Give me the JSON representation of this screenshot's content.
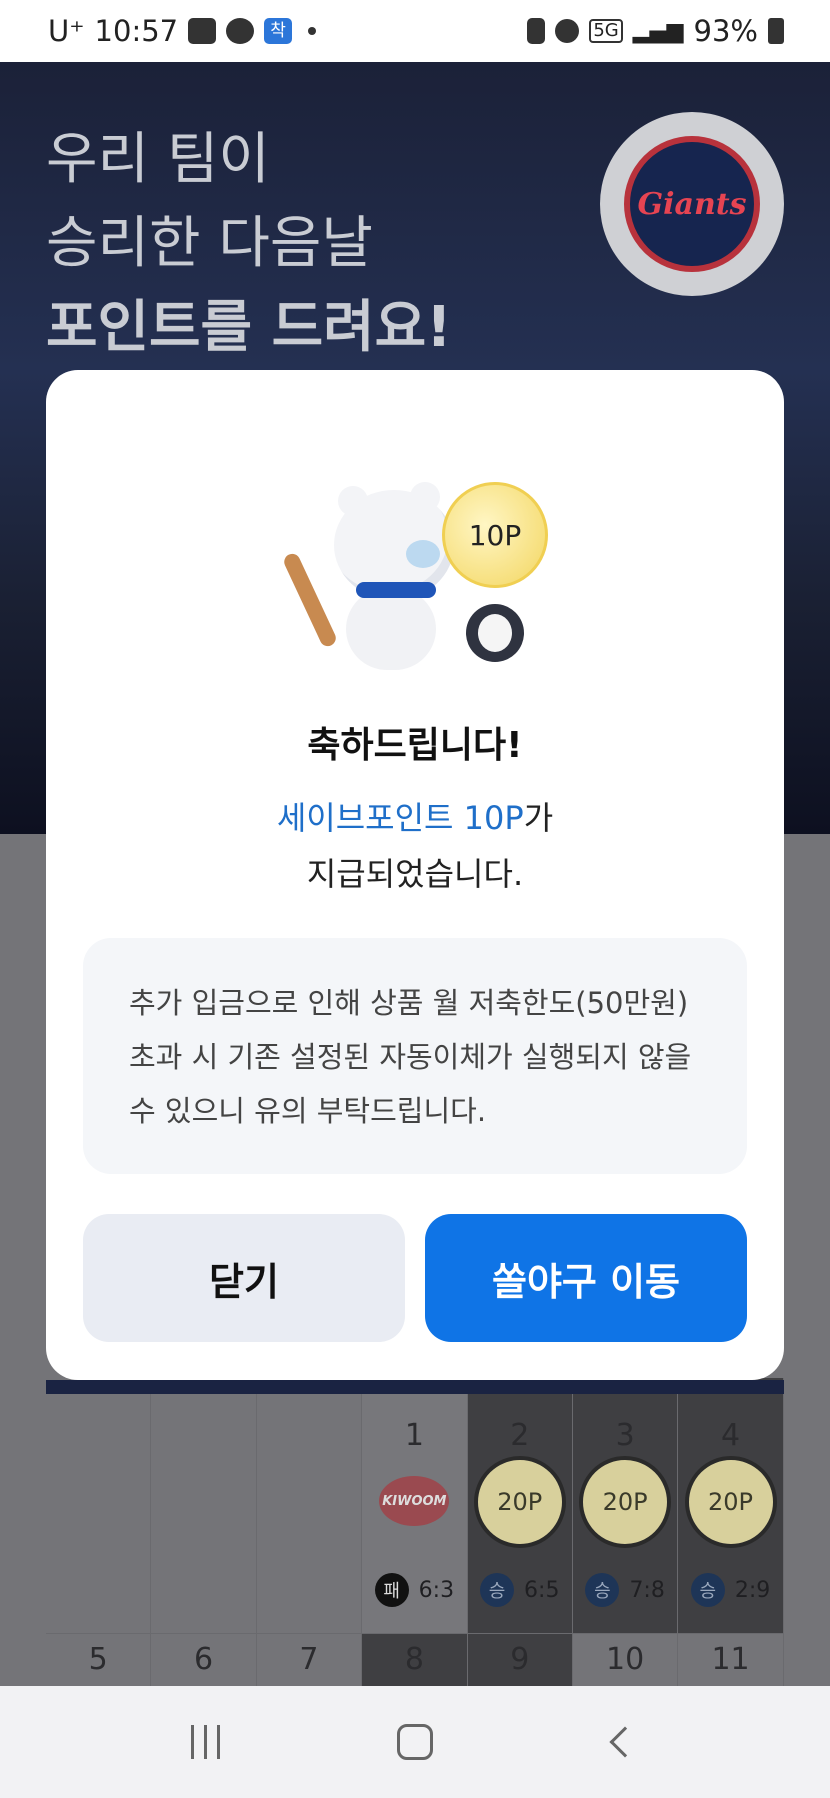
{
  "status_bar": {
    "carrier": "U⁺",
    "time": "10:57",
    "app_badge": "착",
    "network": "5G",
    "battery": "93%"
  },
  "hero": {
    "line1": "우리 팀이",
    "line2": "승리한 다음날",
    "line3": "포인트를 드려요!",
    "team_logo_text": "Giants"
  },
  "modal": {
    "coin_label": "10P",
    "title": "축하드립니다!",
    "message_accent": "세이브포인트 10P",
    "message_suffix": "가",
    "message_line2": "지급되었습니다.",
    "notice": "추가 입금으로 인해 상품 월 저축한도(50만원)초과 시 기존 설정된 자동이체가 실행되지 않을 수 있으니 유의 부탁드립니다.",
    "close_label": "닫기",
    "go_label": "쏠야구 이동"
  },
  "calendar": {
    "week1": [
      {
        "day": "",
        "type": "empty"
      },
      {
        "day": "",
        "type": "empty"
      },
      {
        "day": "",
        "type": "empty"
      },
      {
        "day": "1",
        "type": "lose",
        "opponent": "KIWOOM",
        "badge": "패",
        "score": "6:3"
      },
      {
        "day": "2",
        "type": "win",
        "points": "20P",
        "badge": "승",
        "score": "6:5"
      },
      {
        "day": "3",
        "type": "win",
        "points": "20P",
        "badge": "승",
        "score": "7:8"
      },
      {
        "day": "4",
        "type": "win",
        "points": "20P",
        "badge": "승",
        "score": "2:9"
      }
    ],
    "week2": [
      "5",
      "6",
      "7",
      "8",
      "9",
      "10",
      "11"
    ]
  },
  "colors": {
    "accent": "#0f74e6",
    "accent_text": "#1f6fc9",
    "modal_bg": "#ffffff",
    "close_button_bg": "#e9ecf3"
  }
}
